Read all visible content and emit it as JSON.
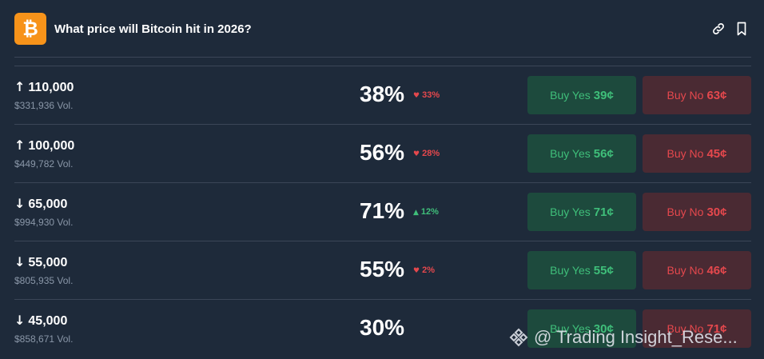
{
  "header": {
    "logo_glyph": "₿",
    "title": "What price will Bitcoin hit in 2026?",
    "icons": [
      "link-icon",
      "bookmark-icon"
    ]
  },
  "colors": {
    "background": "#1e2a3a",
    "brand": "#f7931a",
    "yes": "#3fbf7a",
    "no": "#e5484d"
  },
  "markets": [
    {
      "direction": "up",
      "arrow": "↑",
      "target": "110,000",
      "volume": "$331,936 Vol.",
      "percent": "38%",
      "change_dir": "down",
      "change": "33%",
      "yes_label": "Buy Yes",
      "yes_price": "39¢",
      "no_label": "Buy No",
      "no_price": "63¢"
    },
    {
      "direction": "up",
      "arrow": "↑",
      "target": "100,000",
      "volume": "$449,782 Vol.",
      "percent": "56%",
      "change_dir": "down",
      "change": "28%",
      "yes_label": "Buy Yes",
      "yes_price": "56¢",
      "no_label": "Buy No",
      "no_price": "45¢"
    },
    {
      "direction": "down",
      "arrow": "↓",
      "target": "65,000",
      "volume": "$994,930 Vol.",
      "percent": "71%",
      "change_dir": "up",
      "change": "12%",
      "yes_label": "Buy Yes",
      "yes_price": "71¢",
      "no_label": "Buy No",
      "no_price": "30¢"
    },
    {
      "direction": "down",
      "arrow": "↓",
      "target": "55,000",
      "volume": "$805,935 Vol.",
      "percent": "55%",
      "change_dir": "down",
      "change": "2%",
      "yes_label": "Buy Yes",
      "yes_price": "55¢",
      "no_label": "Buy No",
      "no_price": "46¢"
    },
    {
      "direction": "down",
      "arrow": "↓",
      "target": "45,000",
      "volume": "$858,671 Vol.",
      "percent": "30%",
      "change_dir": "",
      "change": "",
      "yes_label": "Buy Yes",
      "yes_price": "30¢",
      "no_label": "Buy No",
      "no_price": "71¢"
    }
  ],
  "watermark": {
    "text": "@ Trading Insight_Rese..."
  }
}
